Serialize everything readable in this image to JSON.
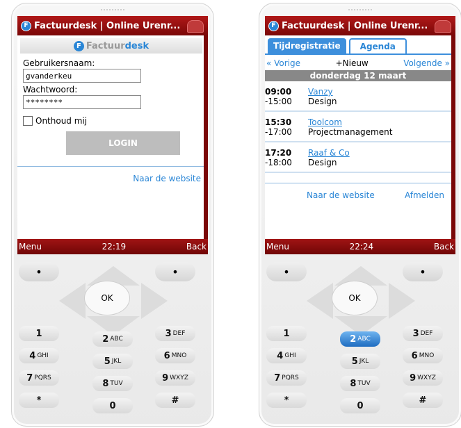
{
  "left": {
    "title": "Factuurdesk | Online Urenr...",
    "brand_fac": "Factuur",
    "brand_desk": "desk",
    "username_label": "Gebruikersnaam:",
    "username_value": "gvanderkeu",
    "password_label": "Wachtwoord:",
    "password_value": "********",
    "remember_label": "Onthoud mij",
    "login_label": "LOGIN",
    "website_link": "Naar de website",
    "softkey_menu": "Menu",
    "clock": "22:19",
    "softkey_back": "Back"
  },
  "right": {
    "title": "Factuurdesk | Online Urenr...",
    "tab_time": "Tijdregistratie",
    "tab_agenda": "Agenda",
    "prev": "« Vorige",
    "new": "+Nieuw",
    "next": "Volgende »",
    "day": "donderdag 12 maart",
    "appointments": [
      {
        "start": "09:00",
        "end": "-15:00",
        "client": "Vanzy",
        "activity": "Design"
      },
      {
        "start": "15:30",
        "end": "-17:00",
        "client": "Toolcom",
        "activity": "Projectmanagement"
      },
      {
        "start": "17:20",
        "end": "-18:00",
        "client": "Raaf & Co",
        "activity": "Design"
      }
    ],
    "website_link": "Naar de website",
    "logout": "Afmelden",
    "softkey_menu": "Menu",
    "clock": "22:24",
    "softkey_back": "Back"
  },
  "keypad": {
    "ok": "OK",
    "soft_left": "•",
    "soft_right": "•",
    "keys": [
      {
        "d": "1",
        "l": ""
      },
      {
        "d": "2",
        "l": "ABC"
      },
      {
        "d": "3",
        "l": "DEF"
      },
      {
        "d": "4",
        "l": "GHI"
      },
      {
        "d": "5",
        "l": "JKL"
      },
      {
        "d": "6",
        "l": "MNO"
      },
      {
        "d": "7",
        "l": "PQRS"
      },
      {
        "d": "8",
        "l": "TUV"
      },
      {
        "d": "9",
        "l": "WXYZ"
      },
      {
        "d": "*",
        "l": ""
      },
      {
        "d": "0",
        "l": ""
      },
      {
        "d": "#",
        "l": ""
      }
    ]
  },
  "colors": {
    "accent": "#2a86d6",
    "titlebar": "#a01414",
    "highlight_key": "#1e6cc0"
  }
}
